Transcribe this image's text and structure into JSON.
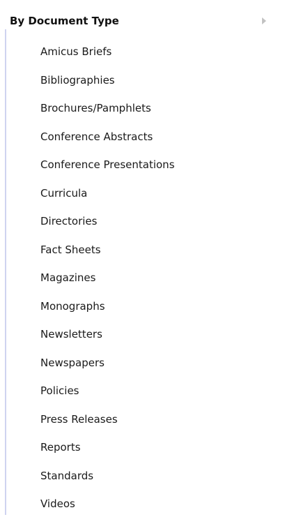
{
  "header": {
    "title": "By Document Type",
    "arrow_icon": "chevron-right-icon"
  },
  "items": [
    {
      "label": "Amicus Briefs"
    },
    {
      "label": "Bibliographies"
    },
    {
      "label": "Brochures/Pamphlets"
    },
    {
      "label": "Conference Abstracts"
    },
    {
      "label": "Conference Presentations"
    },
    {
      "label": "Curricula"
    },
    {
      "label": "Directories"
    },
    {
      "label": "Fact Sheets"
    },
    {
      "label": "Magazines"
    },
    {
      "label": "Monographs"
    },
    {
      "label": "Newsletters"
    },
    {
      "label": "Newspapers"
    },
    {
      "label": "Policies"
    },
    {
      "label": "Press Releases"
    },
    {
      "label": "Reports"
    },
    {
      "label": "Standards"
    },
    {
      "label": "Videos"
    }
  ],
  "colors": {
    "rule": "#cfd3f0",
    "text": "#1a1a1a",
    "arrow": "#c2c2c2"
  }
}
